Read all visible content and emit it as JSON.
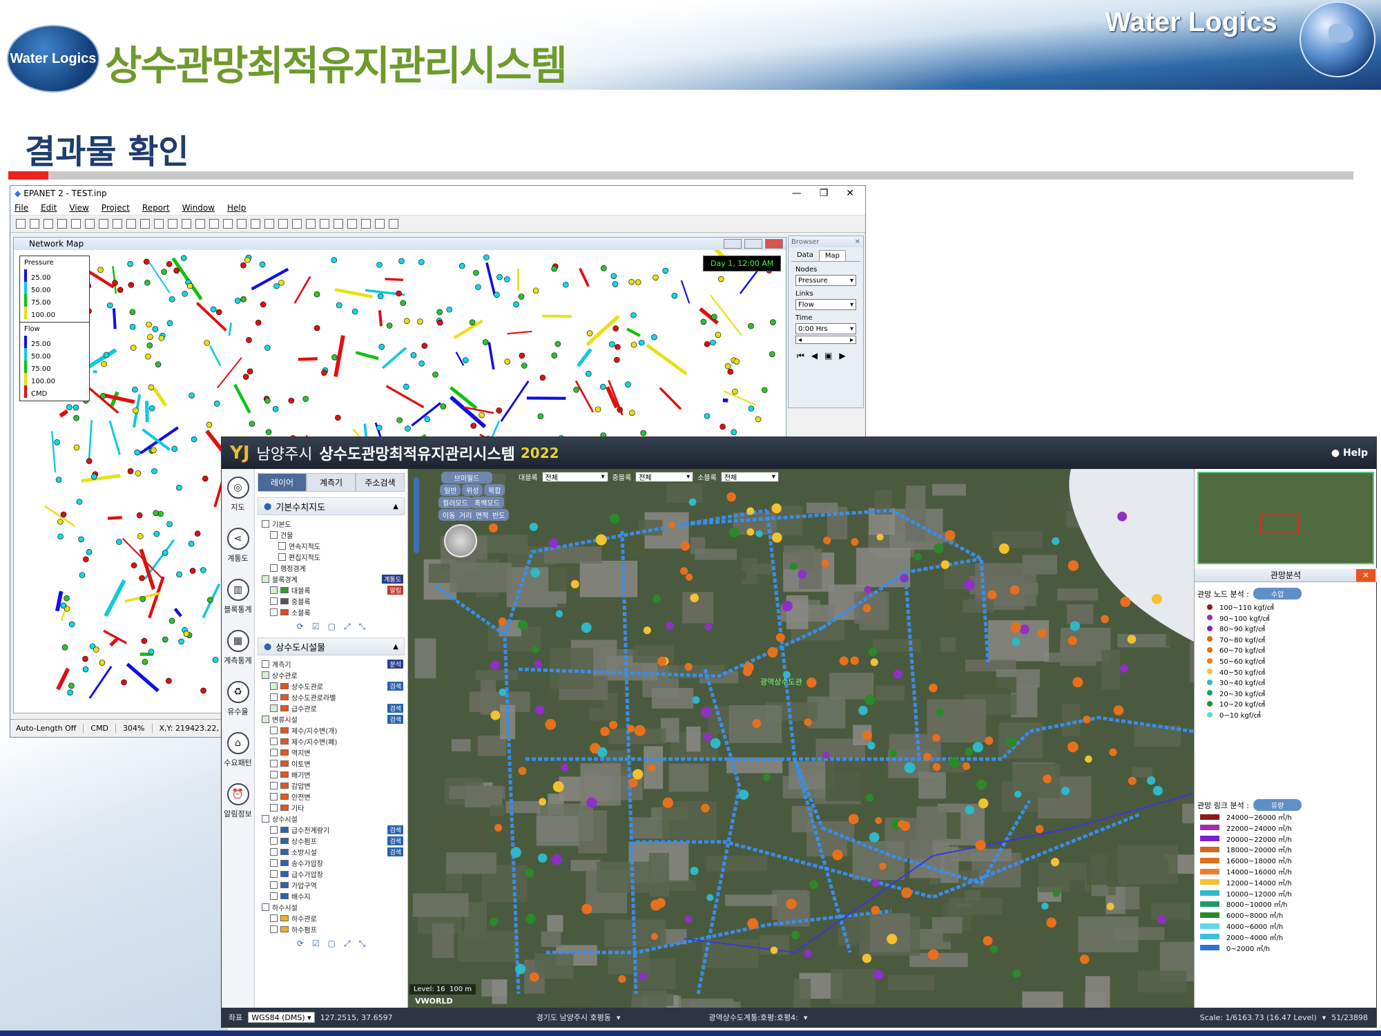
{
  "slide": {
    "logo_text": "Water Logics",
    "title": "상수관망최적유지관리시스템",
    "brand": "Water Logics",
    "subtitle": "결과물 확인"
  },
  "epanet": {
    "title": "EPANET 2 - TEST.inp",
    "menu": [
      "File",
      "Edit",
      "View",
      "Project",
      "Report",
      "Window",
      "Help"
    ],
    "network_map_title": "Network Map",
    "day_badge": "Day 1, 12:00 AM",
    "legend_pressure": {
      "title": "Pressure",
      "items": [
        "25.00",
        "50.00",
        "75.00",
        "100.00"
      ]
    },
    "legend_flow": {
      "title": "Flow",
      "items": [
        "25.00",
        "50.00",
        "75.00",
        "100.00",
        "CMD"
      ]
    },
    "status": {
      "auto_length": "Auto-Length Off",
      "units": "CMD",
      "zoom": "304%",
      "xy": "X,Y: 219423.22,"
    },
    "browser": {
      "title": "Browser",
      "tabs": [
        "Data",
        "Map"
      ],
      "nodes_label": "Nodes",
      "nodes_value": "Pressure",
      "links_label": "Links",
      "links_value": "Flow",
      "time_label": "Time",
      "time_value": "0:00 Hrs"
    }
  },
  "gis": {
    "logo": "YJ",
    "city": "남양주시",
    "system": "상수도관망최적유지관리시스템",
    "year": "2022",
    "help": "Help",
    "nav": [
      "지도",
      "계통도",
      "블록통계",
      "계측통계",
      "유수율",
      "수요패턴",
      "알림정보"
    ],
    "tabs": [
      "레이어",
      "계측기",
      "주소검색"
    ],
    "group1": {
      "title": "기본수치지도",
      "items": [
        "기본도",
        "건물",
        "연속지적도",
        "편집지적도",
        "행정경계",
        "블록경계",
        "대블록",
        "중블록",
        "소블록"
      ],
      "badge1": "계통도",
      "badge2": "알림"
    },
    "group2": {
      "title": "상수도시설물",
      "items": [
        "계측기",
        "상수관로",
        "상수도관로",
        "상수도관로라벨",
        "급수관로",
        "변류시설",
        "제수/지수변(개)",
        "제수/지수변(폐)",
        "역지변",
        "이토변",
        "배기변",
        "감압변",
        "안전변",
        "기타",
        "상수시설",
        "급수전계량기",
        "상수펌프",
        "소방시설",
        "송수가압장",
        "급수가압장",
        "가압구역",
        "배수지",
        "하수시설",
        "하수관로",
        "하수펌프"
      ],
      "badge_analysis": "분석",
      "badge_search": "검색"
    },
    "map_toolbar": {
      "world": "브이월드",
      "modes": [
        "일반",
        "위성",
        "복합"
      ],
      "color_mode": "컬러모드",
      "bw_mode": "흑백모드",
      "tools": [
        "이동",
        "거리",
        "면적",
        "반도"
      ],
      "big_block_label": "대블록",
      "big_block_value": "전체",
      "mid_block_label": "중블록",
      "mid_block_value": "전체",
      "small_block_label": "소블록",
      "small_block_value": "전체"
    },
    "map_level": "Level: 16",
    "map_scale": "100 m",
    "map_brand": "VWORLD",
    "map_label": "광역상수도관",
    "analysis": {
      "title": "관망분석",
      "close": "✕",
      "node_label": "관망 노드 분석 :",
      "node_pill": "수압",
      "link_label": "관망 링크 분석 :",
      "link_pill": "유량",
      "node_items": [
        "100~110 kgf/㎠",
        "90~100 kgf/㎠",
        "80~90 kgf/㎠",
        "70~80 kgf/㎠",
        "60~70 kgf/㎠",
        "50~60 kgf/㎠",
        "40~50 kgf/㎠",
        "30~40 kgf/㎠",
        "20~30 kgf/㎠",
        "10~20 kgf/㎠",
        "0~10 kgf/㎠"
      ],
      "node_colors": [
        "#8b1a1a",
        "#9b2fb0",
        "#7a1fd0",
        "#d2691e",
        "#e0701c",
        "#ef7d2a",
        "#f2c230",
        "#2fb8c8",
        "#1e9a6a",
        "#2a8a2a",
        "#5ed8e8"
      ],
      "link_items": [
        "24000~26000 ㎥/h",
        "22000~24000 ㎥/h",
        "20000~22000 ㎥/h",
        "18000~20000 ㎥/h",
        "16000~18000 ㎥/h",
        "14000~16000 ㎥/h",
        "12000~14000 ㎥/h",
        "10000~12000 ㎥/h",
        "8000~10000 ㎥/h",
        "6000~8000 ㎥/h",
        "4000~6000 ㎥/h",
        "2000~4000 ㎥/h",
        "0~2000 ㎥/h"
      ],
      "link_colors": [
        "#8b1a1a",
        "#9b2fb0",
        "#7a1fd0",
        "#d2691e",
        "#e0701c",
        "#ef7d2a",
        "#f2c230",
        "#2fb8c8",
        "#1e9a6a",
        "#2a8a2a",
        "#5ed8e8",
        "#3fc0d8",
        "#2f6ed8"
      ]
    },
    "status": {
      "coord_label": "좌표",
      "coord_sys": "WGS84 (DMS)",
      "coord_value": "127.2515, 37.6597",
      "location": "경기도 남양주시 호평동",
      "system": "광역상수도계통:호평:호평4:",
      "scale": "Scale: 1/6163.73 (16.47 Level)",
      "count": "51/23898"
    }
  }
}
